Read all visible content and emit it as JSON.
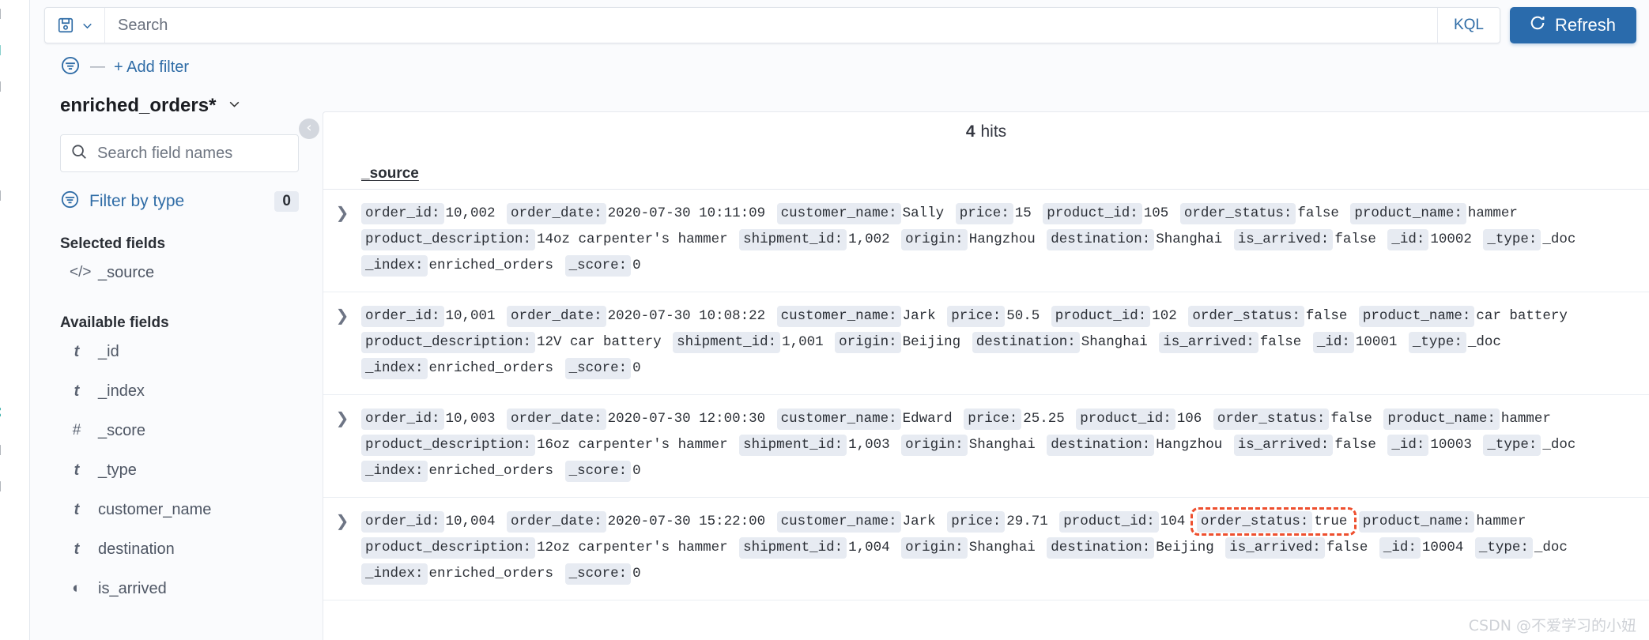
{
  "colors": {
    "accent": "#2a6bac",
    "link": "#2f6ca6",
    "field_key_bg": "#e7ebf2",
    "annotation_red": "#ee4f2e",
    "teal": "#1ba39c"
  },
  "query_bar": {
    "saved_query_icon": "save-disk-icon",
    "saved_query_chevron": "chevron-down-icon",
    "search_placeholder": "Search",
    "search_value": "",
    "language_badge": "KQL",
    "refresh_label": "Refresh",
    "refresh_icon": "refresh-icon"
  },
  "filter_bar": {
    "filter_icon": "filter-icon",
    "separator": "—",
    "add_filter_label": "+ Add filter"
  },
  "sidebar": {
    "index_pattern": "enriched_orders*",
    "index_pattern_chevron": "chevron-down-icon",
    "field_search_placeholder": "Search field names",
    "field_search_value": "",
    "field_search_icon": "search-icon",
    "filter_by_type_icon": "filter-icon",
    "filter_by_type_label": "Filter by type",
    "filter_by_type_count": "0",
    "selected_fields_title": "Selected fields",
    "selected_fields": [
      {
        "type_icon": "</>",
        "name": "_source"
      }
    ],
    "available_fields_title": "Available fields",
    "available_fields": [
      {
        "type_icon": "t",
        "name": "_id"
      },
      {
        "type_icon": "t",
        "name": "_index"
      },
      {
        "type_icon": "#",
        "name": "_score"
      },
      {
        "type_icon": "t",
        "name": "_type"
      },
      {
        "type_icon": "t",
        "name": "customer_name"
      },
      {
        "type_icon": "t",
        "name": "destination"
      },
      {
        "type_icon": "◐",
        "name": "is_arrived"
      }
    ],
    "collapse_icon": "chevron-left-circle-icon"
  },
  "documents": {
    "hits_count": "4",
    "hits_label": "hits",
    "column_header": "_source",
    "expand_icon": "chevron-right-icon",
    "rows": [
      {
        "pairs": [
          {
            "key": "order_id:",
            "value": "10,002"
          },
          {
            "key": "order_date:",
            "value": "2020-07-30 10:11:09"
          },
          {
            "key": "customer_name:",
            "value": "Sally"
          },
          {
            "key": "price:",
            "value": "15"
          },
          {
            "key": "product_id:",
            "value": "105"
          },
          {
            "key": "order_status:",
            "value": "false"
          },
          {
            "key": "product_name:",
            "value": "hammer"
          },
          {
            "key": "product_description:",
            "value": "14oz carpenter's hammer"
          },
          {
            "key": "shipment_id:",
            "value": "1,002"
          },
          {
            "key": "origin:",
            "value": "Hangzhou"
          },
          {
            "key": "destination:",
            "value": "Shanghai"
          },
          {
            "key": "is_arrived:",
            "value": "false"
          },
          {
            "key": "_id:",
            "value": "10002"
          },
          {
            "key": "_type:",
            "value": "_doc"
          },
          {
            "key": "_index:",
            "value": "enriched_orders"
          },
          {
            "key": "_score:",
            "value": "0"
          }
        ]
      },
      {
        "pairs": [
          {
            "key": "order_id:",
            "value": "10,001"
          },
          {
            "key": "order_date:",
            "value": "2020-07-30 10:08:22"
          },
          {
            "key": "customer_name:",
            "value": "Jark"
          },
          {
            "key": "price:",
            "value": "50.5"
          },
          {
            "key": "product_id:",
            "value": "102"
          },
          {
            "key": "order_status:",
            "value": "false"
          },
          {
            "key": "product_name:",
            "value": "car battery"
          },
          {
            "key": "product_description:",
            "value": "12V car battery"
          },
          {
            "key": "shipment_id:",
            "value": "1,001"
          },
          {
            "key": "origin:",
            "value": "Beijing"
          },
          {
            "key": "destination:",
            "value": "Shanghai"
          },
          {
            "key": "is_arrived:",
            "value": "false"
          },
          {
            "key": "_id:",
            "value": "10001"
          },
          {
            "key": "_type:",
            "value": "_doc"
          },
          {
            "key": "_index:",
            "value": "enriched_orders"
          },
          {
            "key": "_score:",
            "value": "0"
          }
        ]
      },
      {
        "pairs": [
          {
            "key": "order_id:",
            "value": "10,003"
          },
          {
            "key": "order_date:",
            "value": "2020-07-30 12:00:30"
          },
          {
            "key": "customer_name:",
            "value": "Edward"
          },
          {
            "key": "price:",
            "value": "25.25"
          },
          {
            "key": "product_id:",
            "value": "106"
          },
          {
            "key": "order_status:",
            "value": "false"
          },
          {
            "key": "product_name:",
            "value": "hammer"
          },
          {
            "key": "product_description:",
            "value": "16oz carpenter's hammer"
          },
          {
            "key": "shipment_id:",
            "value": "1,003"
          },
          {
            "key": "origin:",
            "value": "Shanghai"
          },
          {
            "key": "destination:",
            "value": "Hangzhou"
          },
          {
            "key": "is_arrived:",
            "value": "false"
          },
          {
            "key": "_id:",
            "value": "10003"
          },
          {
            "key": "_type:",
            "value": "_doc"
          },
          {
            "key": "_index:",
            "value": "enriched_orders"
          },
          {
            "key": "_score:",
            "value": "0"
          }
        ]
      },
      {
        "pairs": [
          {
            "key": "order_id:",
            "value": "10,004"
          },
          {
            "key": "order_date:",
            "value": "2020-07-30 15:22:00"
          },
          {
            "key": "customer_name:",
            "value": "Jark"
          },
          {
            "key": "price:",
            "value": "29.71"
          },
          {
            "key": "product_id:",
            "value": "104"
          },
          {
            "key": "order_status:",
            "value": "true",
            "highlighted": true
          },
          {
            "key": "product_name:",
            "value": "hammer"
          },
          {
            "key": "product_description:",
            "value": "12oz carpenter's hammer"
          },
          {
            "key": "shipment_id:",
            "value": "1,004"
          },
          {
            "key": "origin:",
            "value": "Shanghai"
          },
          {
            "key": "destination:",
            "value": "Beijing"
          },
          {
            "key": "is_arrived:",
            "value": "false"
          },
          {
            "key": "_id:",
            "value": "10004"
          },
          {
            "key": "_type:",
            "value": "_doc"
          },
          {
            "key": "_index:",
            "value": "enriched_orders"
          },
          {
            "key": "_score:",
            "value": "0"
          }
        ]
      }
    ]
  },
  "nav_rail": {
    "icons": [
      "dashboard-icon",
      "discover-icon",
      "visualize-icon",
      "canvas-icon",
      "maps-icon",
      "machine-learning-icon",
      "infrastructure-icon",
      "logs-icon",
      "apm-icon",
      "uptime-icon",
      "siem-icon",
      "dev-tools-icon",
      "monitoring-icon",
      "management-icon"
    ]
  },
  "watermark": "CSDN @不爱学习的小妞"
}
